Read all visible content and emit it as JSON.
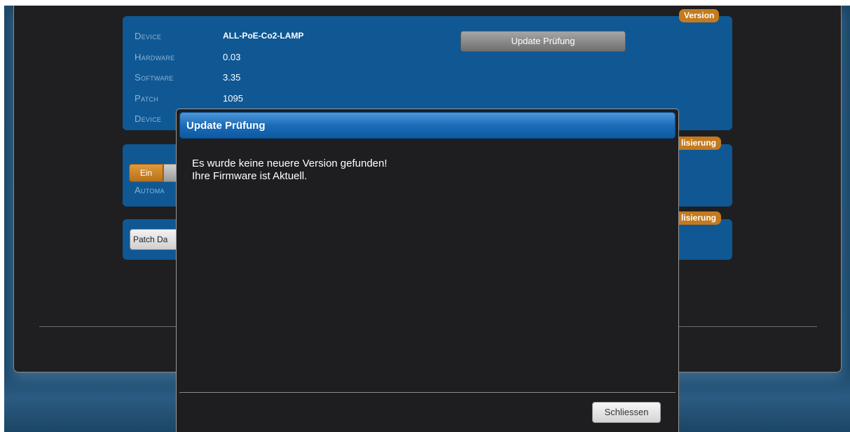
{
  "version_card": {
    "badge": "Version",
    "rows": [
      {
        "label": "Device",
        "value": "ALL-PoE-Co2-LAMP"
      },
      {
        "label": "Hardware",
        "value": "0.03"
      },
      {
        "label": "Software",
        "value": "3.35"
      },
      {
        "label": "Patch",
        "value": "1095"
      },
      {
        "label": "Device",
        "value": ""
      }
    ],
    "update_button": "Update Prüfung"
  },
  "auto_card": {
    "badge": "lisierung",
    "toggle_label": "Ein",
    "label": "Automa"
  },
  "patch_card": {
    "badge": "lisierung",
    "button_label": "Patch Da"
  },
  "dialog": {
    "title": "Update Prüfung",
    "message_line1": "Es wurde keine neuere Version gefunden!",
    "message_line2": "Ihre Firmware ist Aktuell.",
    "close_label": "Schliessen"
  },
  "colors": {
    "card_blue": "#0f5894",
    "badge_orange": "#c47a1e",
    "dialog_bg": "#1e1e20",
    "title_blue": "#1b6cb8"
  }
}
